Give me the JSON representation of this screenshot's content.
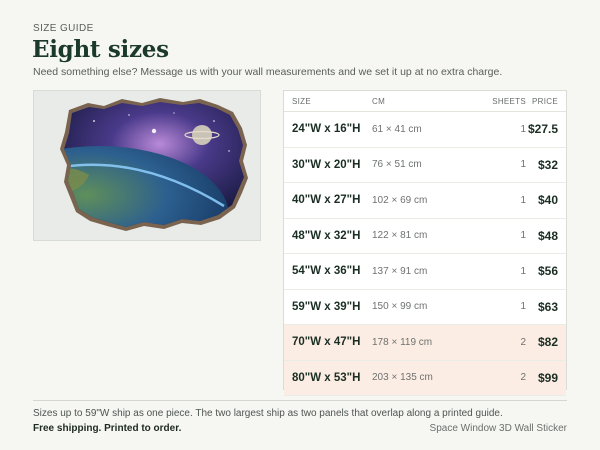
{
  "header": {
    "eyebrow": "SIZE GUIDE",
    "title": "Eight sizes",
    "subtitle": "Need something else? Message us with your wall measurements and we set it up at no extra charge."
  },
  "preview": {
    "image": "space-window-wall-sticker-preview",
    "colors": {
      "wall": "#e8ebe7",
      "space": "#141a3a",
      "planet": "#2f6fb0",
      "edge": "#6a5240"
    }
  },
  "table": {
    "columns": {
      "size": "SIZE",
      "cm": "CM",
      "sheets": "SHEETS",
      "price": "PRICE"
    },
    "rows": [
      {
        "size": "24\"W x 16\"H",
        "cm": "61 × 41 cm",
        "sheets": "1",
        "price": "$27.5",
        "highlight": false
      },
      {
        "size": "30\"W x 20\"H",
        "cm": "76 × 51 cm",
        "sheets": "1",
        "price": "$32",
        "highlight": false
      },
      {
        "size": "40\"W x 27\"H",
        "cm": "102 × 69 cm",
        "sheets": "1",
        "price": "$40",
        "highlight": false
      },
      {
        "size": "48\"W x 32\"H",
        "cm": "122 × 81 cm",
        "sheets": "1",
        "price": "$48",
        "highlight": false
      },
      {
        "size": "54\"W x 36\"H",
        "cm": "137 × 91 cm",
        "sheets": "1",
        "price": "$56",
        "highlight": false
      },
      {
        "size": "59\"W x 39\"H",
        "cm": "150 × 99 cm",
        "sheets": "1",
        "price": "$63",
        "highlight": false
      },
      {
        "size": "70\"W x 47\"H",
        "cm": "178 × 119 cm",
        "sheets": "2",
        "price": "$82",
        "highlight": true
      },
      {
        "size": "80\"W x 53\"H",
        "cm": "203 × 135 cm",
        "sheets": "2",
        "price": "$99",
        "highlight": true
      }
    ],
    "highlight_color": "#fcede4"
  },
  "footer": {
    "note": "Sizes up to 59\"W ship as one piece. The two largest ship as two panels that overlap along a printed guide.",
    "shipping": "Free shipping. Printed to order.",
    "product": "Space Window 3D Wall Sticker"
  }
}
